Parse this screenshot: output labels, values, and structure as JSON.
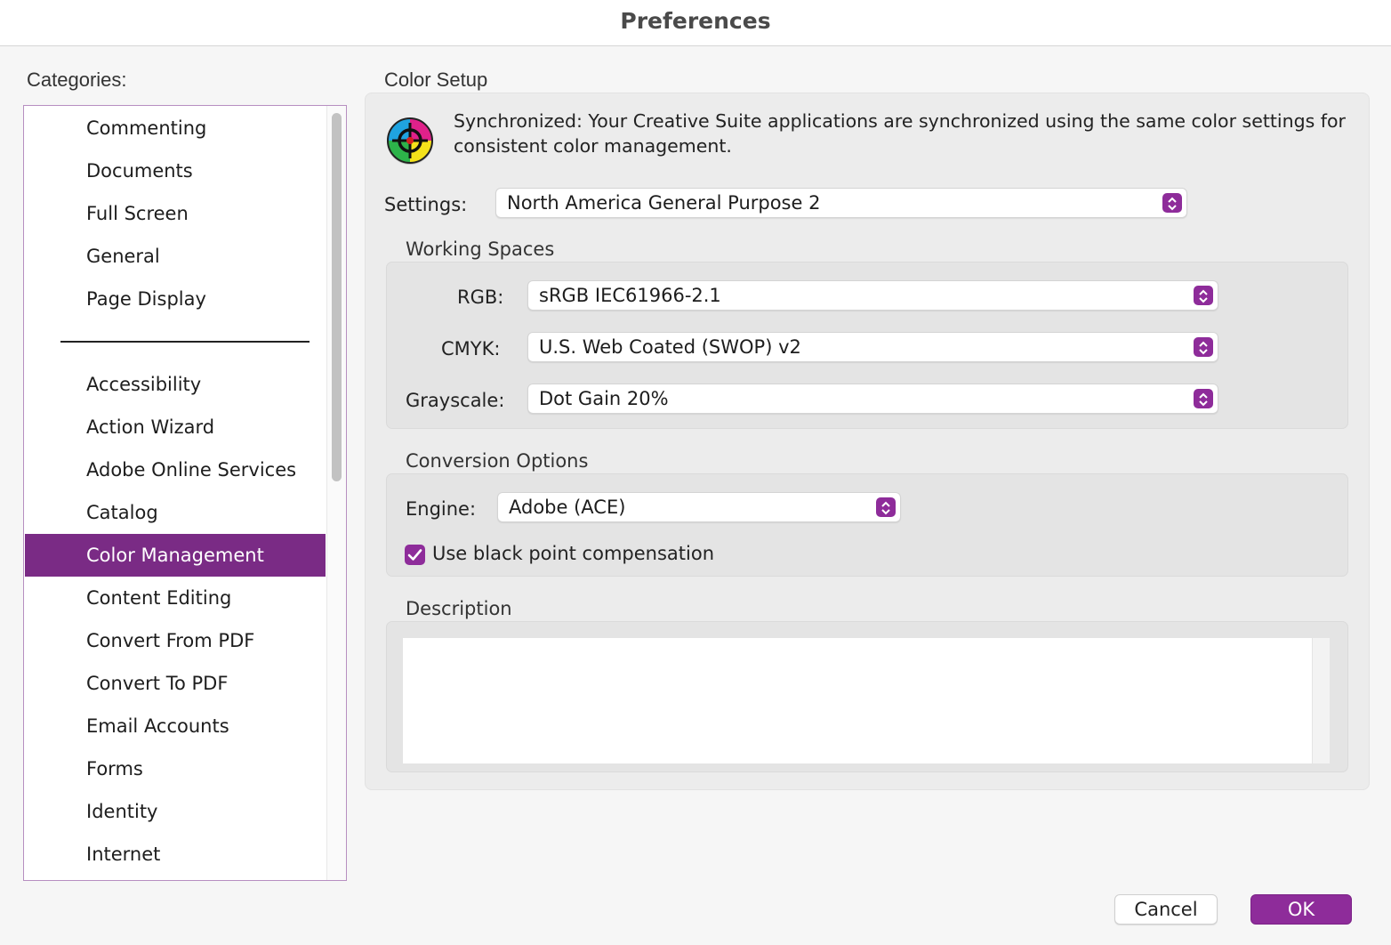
{
  "window": {
    "title": "Preferences"
  },
  "sidebar": {
    "label": "Categories:",
    "items": [
      {
        "label": "Commenting"
      },
      {
        "label": "Documents"
      },
      {
        "label": "Full Screen"
      },
      {
        "label": "General"
      },
      {
        "label": "Page Display"
      },
      {
        "label": "Accessibility"
      },
      {
        "label": "Action Wizard"
      },
      {
        "label": "Adobe Online Services"
      },
      {
        "label": "Catalog"
      },
      {
        "label": "Color Management",
        "selected": true
      },
      {
        "label": "Content Editing"
      },
      {
        "label": "Convert From PDF"
      },
      {
        "label": "Convert To PDF"
      },
      {
        "label": "Email Accounts"
      },
      {
        "label": "Forms"
      },
      {
        "label": "Identity"
      },
      {
        "label": "Internet"
      }
    ]
  },
  "color_setup": {
    "label": "Color Setup",
    "sync_message": "Synchronized: Your Creative Suite applications are synchronized using the same color settings for consistent color management.",
    "settings_label": "Settings:",
    "settings_value": "North America General Purpose 2"
  },
  "working_spaces": {
    "title": "Working Spaces",
    "rgb_label": "RGB:",
    "rgb_value": "sRGB IEC61966-2.1",
    "cmyk_label": "CMYK:",
    "cmyk_value": "U.S. Web Coated (SWOP) v2",
    "grayscale_label": "Grayscale:",
    "grayscale_value": "Dot Gain 20%"
  },
  "conversion_options": {
    "title": "Conversion Options",
    "engine_label": "Engine:",
    "engine_value": "Adobe (ACE)",
    "black_point_label": "Use black point compensation",
    "black_point_checked": true
  },
  "description": {
    "title": "Description",
    "text": ""
  },
  "buttons": {
    "cancel": "Cancel",
    "ok": "OK"
  },
  "colors": {
    "accent": "#8e2c9a",
    "selection": "#7a2b85"
  }
}
